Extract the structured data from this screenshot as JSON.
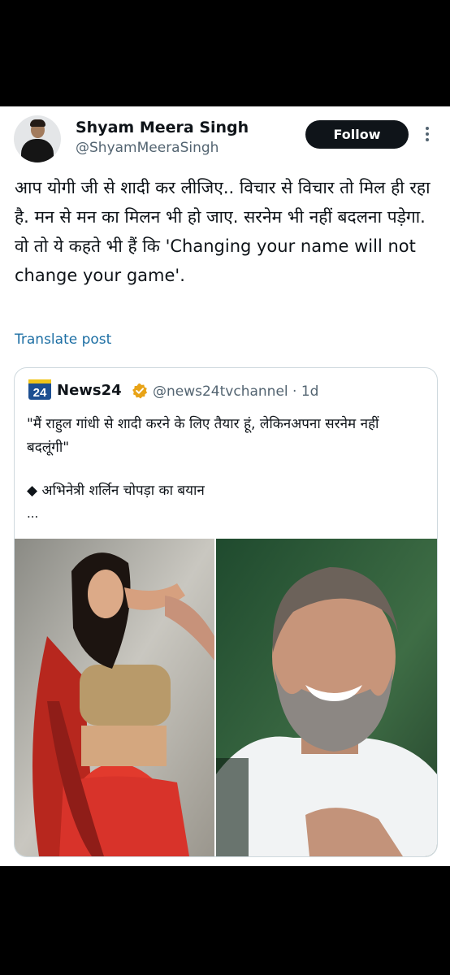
{
  "post": {
    "author": {
      "name": "Shyam Meera Singh",
      "handle": "@ShyamMeeraSingh"
    },
    "follow_label": "Follow",
    "text": "आप योगी जी से शादी कर लीजिए.. विचार से विचार तो मिल ही रहा है. मन से मन का मिलन भी हो जाए. सरनेम भी नहीं बदलना पड़ेगा. वो तो ये कहते भी हैं कि 'Changing your name will not change your game'.",
    "translate_label": "Translate post",
    "quoted": {
      "logo_text": "24",
      "name": "News24",
      "handle": "@news24tvchannel",
      "time": "1d",
      "text": "\"मैं राहुल गांधी से शादी करने के लिए तैयार हूं, लेकिनअपना सरनेम नहीं बदलूंगी\"",
      "bullet_text": "◆ अभिनेत्री शर्लिन चोपड़ा का बयान",
      "ellipsis": "..."
    }
  },
  "colors": {
    "text": "#0f1419",
    "secondary": "#536471",
    "link": "#1d6fa4",
    "verified_gold": "#e8a317",
    "follow_bg": "#0f1419",
    "background": "#000000"
  },
  "icons": {
    "more": "more-vertical-icon",
    "verified": "verified-badge-icon"
  }
}
